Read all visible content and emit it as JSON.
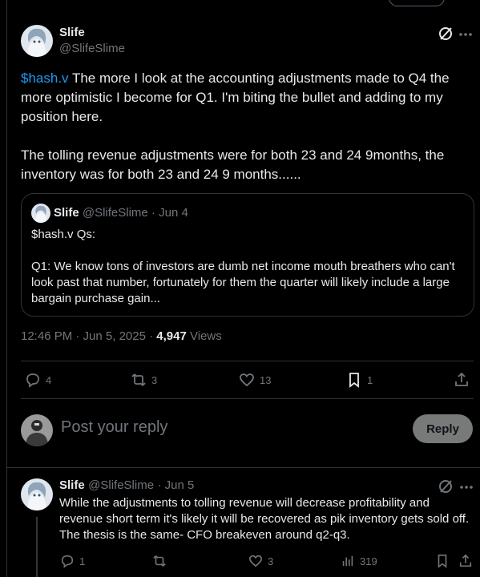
{
  "main_post": {
    "author_name": "Slife",
    "author_handle": "@SlifeSlime",
    "cashtag": "$hash.v",
    "text_line1_rest": " The more I look at the accounting adjustments made to Q4 the more optimistic I become for Q1. I'm biting the bullet and adding to my position here.",
    "text_para2": "The tolling revenue adjustments were for both 23 and 24 9months, the inventory was for both 23 and 24 9 months......",
    "quote": {
      "author_name": "Slife",
      "author_handle": "@SlifeSlime",
      "date": "· Jun 4",
      "line1": "$hash.v Qs:",
      "line2": "Q1: We know tons of investors are dumb net income mouth breathers who can't look past that number, fortunately for them the quarter will likely include a large bargain purchase gain..."
    },
    "timestamp": "12:46 PM · Jun 5, 2025 · ",
    "views_count": "4,947",
    "views_label": " Views",
    "actions": {
      "replies": "4",
      "reposts": "3",
      "likes": "13",
      "bookmarks": "1"
    }
  },
  "composer": {
    "placeholder": "Post your reply",
    "reply_button": "Reply"
  },
  "reply_post": {
    "author_name": "Slife",
    "author_handle": "@SlifeSlime",
    "date": "· Jun 5",
    "text": "While the adjustments to tolling revenue will decrease profitability and revenue short term it's likely it will be recovered as pik inventory gets sold off. The thesis is the same- CFO breakeven around q2-q3.",
    "actions": {
      "replies": "1",
      "reposts": "",
      "likes": "3",
      "views": "319"
    }
  },
  "colors": {
    "background": "#000000",
    "text": "#e7e9ea",
    "muted": "#71767b",
    "link": "#1d9bf0",
    "border": "#2f3336"
  }
}
